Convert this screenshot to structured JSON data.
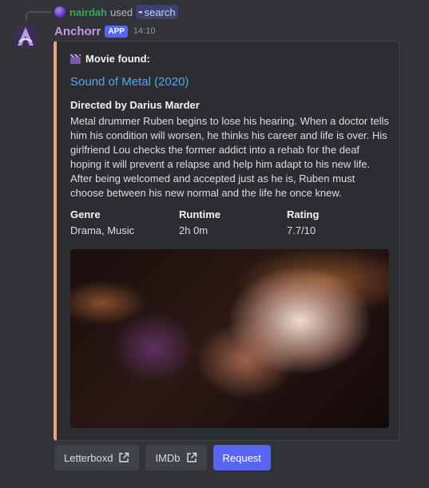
{
  "reply": {
    "user": "nairdah",
    "used_text": "used",
    "command": "search"
  },
  "message": {
    "author": "Anchorr",
    "badge": "APP",
    "timestamp": "14:10"
  },
  "embed": {
    "accent_color": "#e8a57c",
    "author": "Movie found:",
    "title": "Sound of Metal (2020)",
    "director": "Directed by Darius Marder",
    "description": "Metal drummer Ruben begins to lose his hearing. When a doctor tells him his condition will worsen, he thinks his career and life is over. His girlfriend Lou checks the former addict into a rehab for the deaf hoping it will prevent a relapse and help him adapt to his new life. After being welcomed and accepted just as he is, Ruben must choose between his new normal and the life he once knew.",
    "fields": [
      {
        "name": "Genre",
        "value": "Drama, Music"
      },
      {
        "name": "Runtime",
        "value": "2h 0m"
      },
      {
        "name": "Rating",
        "value": "7.7/10"
      }
    ]
  },
  "buttons": [
    {
      "label": "Letterboxd",
      "icon": "external-link-icon"
    },
    {
      "label": "IMDb",
      "icon": "external-link-icon"
    },
    {
      "label": "Request"
    }
  ]
}
